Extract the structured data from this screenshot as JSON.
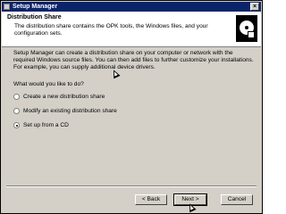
{
  "window": {
    "title": "Setup Manager",
    "close_glyph": "×"
  },
  "header": {
    "title": "Distribution Share",
    "subtitle": "The distribution share contains the OPK tools, the Windows files, and your configuration sets.",
    "icon": "distribution-disc-icon"
  },
  "body": {
    "intro": "Setup Manager can create a distribution share on your computer or network with the required Windows source files. You can then add files to further customize your installations. For example, you can supply additional device drivers.",
    "question": "What would you like to do?",
    "options": [
      {
        "label": "Create a new distribution share",
        "selected": false
      },
      {
        "label": "Modify an existing distribution share",
        "selected": false
      },
      {
        "label": "Set up from a CD",
        "selected": true
      }
    ]
  },
  "buttons": {
    "back": "< Back",
    "next": "Next >",
    "cancel": "Cancel"
  }
}
